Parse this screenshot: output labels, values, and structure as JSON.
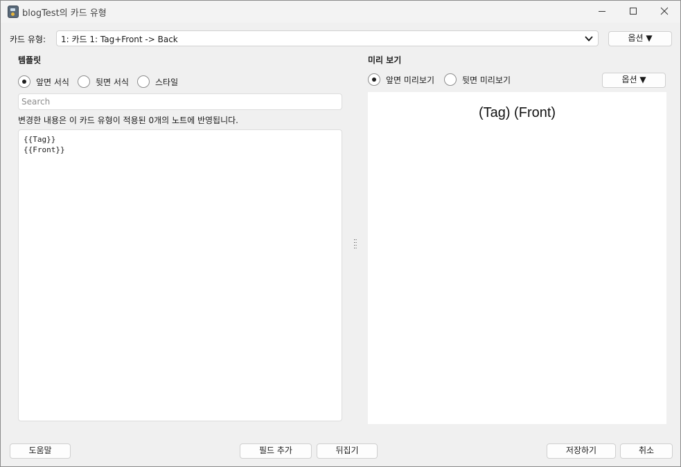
{
  "window": {
    "title": "blogTest의 카드 유형"
  },
  "note_type": {
    "label": "카드 유형:",
    "value": "1: 카드 1: Tag+Front -> Back",
    "options_button": "옵션 ▼"
  },
  "template": {
    "section_title": "템플릿",
    "radios": [
      {
        "label": "앞면 서식",
        "checked": true
      },
      {
        "label": "뒷면 서식",
        "checked": false
      },
      {
        "label": "스타일",
        "checked": false
      }
    ],
    "search_placeholder": "Search",
    "notice": "변경한 내용은 이 카드 유형이 적용된 0개의 노트에 반영됩니다.",
    "editor_lines": [
      "{{Tag}}",
      "{{Front}}"
    ]
  },
  "preview": {
    "section_title": "미리 보기",
    "radios": [
      {
        "label": "앞면 미리보기",
        "checked": true
      },
      {
        "label": "뒷면 미리보기",
        "checked": false
      }
    ],
    "options_button": "옵션 ▼",
    "content": "(Tag) (Front)"
  },
  "buttons": {
    "help": "도움말",
    "add_field": "필드 추가",
    "flip": "뒤집기",
    "save": "저장하기",
    "cancel": "취소"
  },
  "icons": {
    "app": "anki-app-icon",
    "minimize": "minimize-icon",
    "maximize": "maximize-icon",
    "close": "close-icon",
    "dropdown": "chevron-down-icon",
    "splitter": "splitter-handle-icon"
  }
}
